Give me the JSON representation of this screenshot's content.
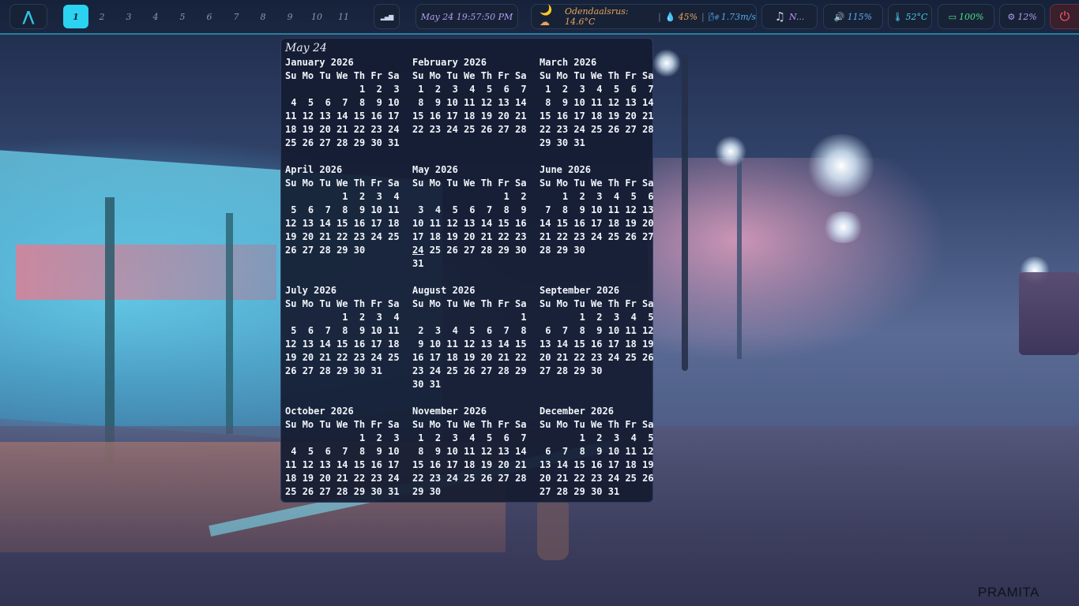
{
  "topbar": {
    "logo_glyph": "⋀",
    "workspaces": [
      "1",
      "2",
      "3",
      "4",
      "5",
      "6",
      "7",
      "8",
      "9",
      "10",
      "11"
    ],
    "active_workspace": "1",
    "signal_glyph": "▂▄▆",
    "clock": "May 24 19:57:50 PM",
    "weather": {
      "icon": "🌙☁",
      "text": "Odendaalsrus: 14.6°C",
      "humidity_icon": "💧",
      "humidity": "45%",
      "wind_icon": "🌬",
      "wind": "1.73m/s"
    },
    "music": {
      "icon": "♫",
      "text": "N..."
    },
    "volume": {
      "icon": "🔊",
      "text": "115%"
    },
    "temperature": {
      "icon": "🌡",
      "text": "52°C"
    },
    "battery": {
      "icon": "▭",
      "text": "100%"
    },
    "cpu": {
      "icon": "⚙",
      "text": "12%"
    },
    "power_icon": "⏻"
  },
  "calendar": {
    "title": "May 24",
    "year": "2026",
    "today": {
      "month_index": 4,
      "day": 24
    },
    "weekday_header": "Su Mo Tu We Th Fr Sa",
    "months": [
      {
        "name": "January 2026",
        "first_weekday": 4,
        "days": 31
      },
      {
        "name": "February 2026",
        "first_weekday": 0,
        "days": 28
      },
      {
        "name": "March 2026",
        "first_weekday": 0,
        "days": 31
      },
      {
        "name": "April 2026",
        "first_weekday": 3,
        "days": 30
      },
      {
        "name": "May 2026",
        "first_weekday": 5,
        "days": 31
      },
      {
        "name": "June 2026",
        "first_weekday": 1,
        "days": 30
      },
      {
        "name": "July 2026",
        "first_weekday": 3,
        "days": 31
      },
      {
        "name": "August 2026",
        "first_weekday": 6,
        "days": 31
      },
      {
        "name": "September 2026",
        "first_weekday": 2,
        "days": 30
      },
      {
        "name": "October 2026",
        "first_weekday": 4,
        "days": 31
      },
      {
        "name": "November 2026",
        "first_weekday": 0,
        "days": 30
      },
      {
        "name": "December 2026",
        "first_weekday": 2,
        "days": 31
      }
    ]
  },
  "wallpaper": {
    "signature": "PRAMITA"
  }
}
